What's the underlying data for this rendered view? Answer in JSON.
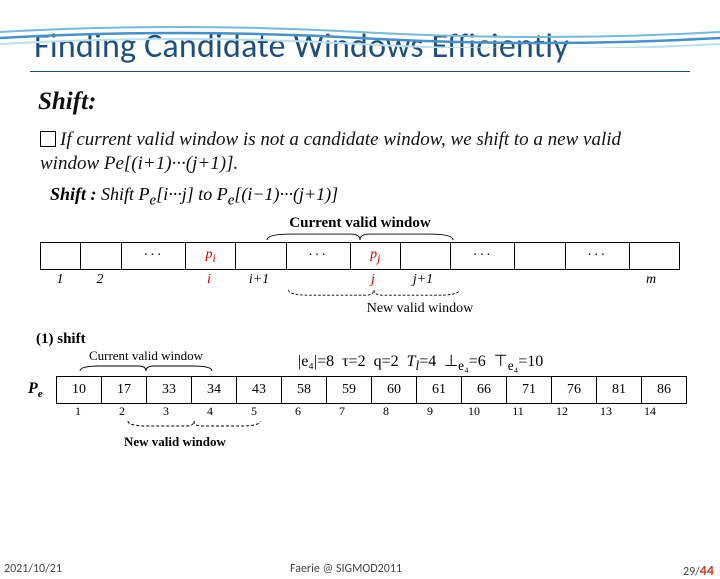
{
  "title": "Finding Candidate Windows Efficiently",
  "subtitle": "Shift:",
  "body": "If current valid window is not a candidate window, we shift to a new valid window Pe[(i+1)···(j+1)].",
  "shift_line": {
    "label": "Shift :",
    "text_a": "Shift P",
    "sub_e1": "e",
    "brkt1": "[i···j] to P",
    "sub_e2": "e",
    "brkt2": "[(i−1)···(j+1)]"
  },
  "diagram1": {
    "cvw": "Current valid window",
    "cells_left": [
      "",
      ""
    ],
    "dots1": "···",
    "pi": "p",
    "pi_sub": "i",
    "dots2": "···",
    "pj": "p",
    "pj_sub": "j",
    "dots3": "···",
    "dots4": "···",
    "axis": [
      "1",
      "2",
      "i",
      "i+1",
      "j",
      "j+1",
      "m"
    ],
    "nvw": "New valid window"
  },
  "step": "(1) shift",
  "cvw2": "Current valid window",
  "params": {
    "e4": "|e₄|=8",
    "tau": "τ=2",
    "q": "q=2",
    "Tl": "T",
    "Tl_sub": "l",
    "Tl_val": "=4",
    "perp": "⊥",
    "perp_sub": "e₄",
    "perp_val": "=6",
    "top": "⊤",
    "top_sub": "e₄",
    "top_val": "=10"
  },
  "pe": {
    "label": "P",
    "sub": "e",
    "values": [
      "10",
      "17",
      "33",
      "34",
      "43",
      "58",
      "59",
      "60",
      "61",
      "66",
      "71",
      "76",
      "81",
      "86"
    ],
    "indices": [
      "1",
      "2",
      "3",
      "4",
      "5",
      "6",
      "7",
      "8",
      "9",
      "10",
      "11",
      "12",
      "13",
      "14"
    ]
  },
  "nvw2": "New valid window",
  "footer": {
    "date": "2021/10/21",
    "mid": "Faerie @ SIGMOD2011",
    "page_cur": "29",
    "page_tot": "44"
  }
}
